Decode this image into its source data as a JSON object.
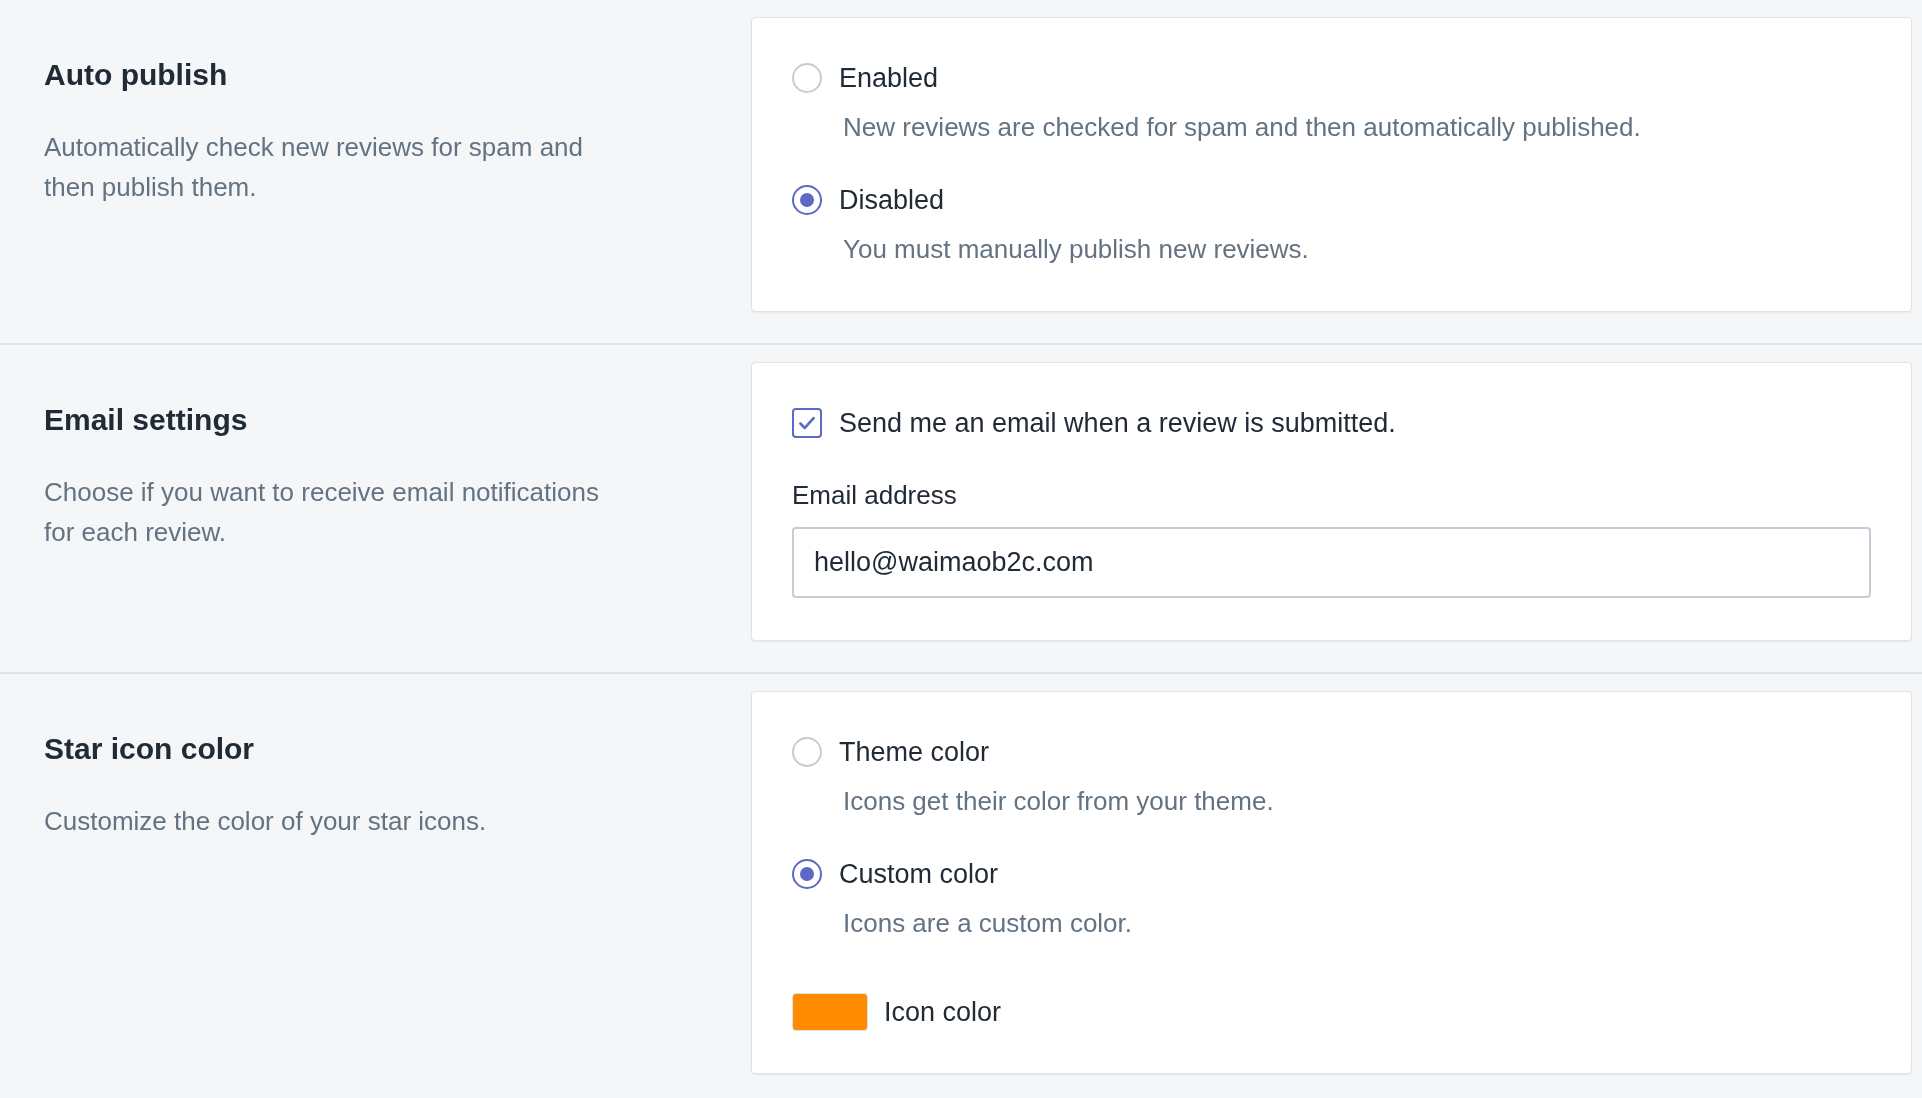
{
  "sections": [
    {
      "title": "Auto publish",
      "description": "Automatically check new reviews for spam and then publish them.",
      "items": [
        {
          "kind": "radio",
          "label": "Enabled",
          "help": "New reviews are checked for spam and then automatically published.",
          "selected": false
        },
        {
          "kind": "radio",
          "label": "Disabled",
          "help": "You must manually publish new reviews.",
          "selected": true
        }
      ]
    },
    {
      "title": "Email settings",
      "description": "Choose if you want to receive email notifications for each review.",
      "items": [
        {
          "kind": "checkbox",
          "label": "Send me an email when a review is submitted.",
          "checked": true
        },
        {
          "kind": "text_field",
          "label": "Email address",
          "value": "hello@waimaob2c.com"
        }
      ]
    },
    {
      "title": "Star icon color",
      "description": "Customize the color of your star icons.",
      "items": [
        {
          "kind": "radio",
          "label": "Theme color",
          "help": "Icons get their color from your theme.",
          "selected": false
        },
        {
          "kind": "radio",
          "label": "Custom color",
          "help": "Icons are a custom color.",
          "selected": true
        },
        {
          "kind": "color_swatch",
          "label": "Icon color",
          "color": "#ff8c00"
        }
      ]
    }
  ]
}
